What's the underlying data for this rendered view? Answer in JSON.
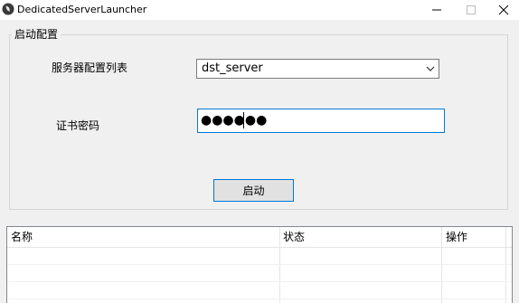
{
  "window": {
    "title": "DedicatedServerLauncher"
  },
  "group": {
    "legend": "启动配置",
    "server_list_label": "服务器配置列表",
    "server_list_value": "dst_server",
    "password_label": "证书密码",
    "password_value": "●●●●●●",
    "start_button_label": "启动"
  },
  "list": {
    "columns": [
      "名称",
      "状态",
      "操作"
    ]
  },
  "colors": {
    "focus_border": "#0078d7",
    "window_bg": "#f0f0f0"
  }
}
